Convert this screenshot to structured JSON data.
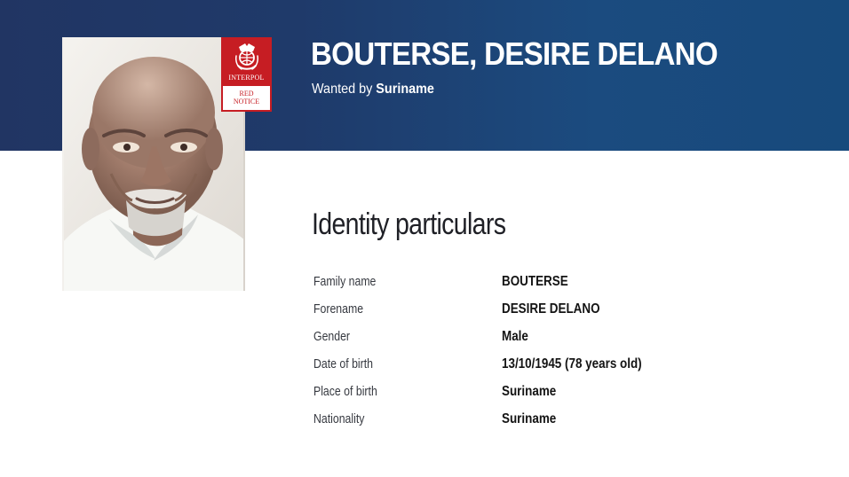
{
  "header": {
    "name": "BOUTERSE, DESIRE DELANO",
    "wanted_prefix": "Wanted by",
    "wanted_country": "Suriname"
  },
  "notice_badge": {
    "organization": "INTERPOL",
    "line_1": "RED",
    "line_2": "NOTICE",
    "background_color": "#c61d23",
    "icon": "interpol-emblem-icon"
  },
  "photo": {
    "description": "portrait-photo"
  },
  "identity": {
    "title": "Identity particulars",
    "rows": [
      {
        "label": "Family name",
        "value": "BOUTERSE"
      },
      {
        "label": "Forename",
        "value": "DESIRE DELANO"
      },
      {
        "label": "Gender",
        "value": "Male"
      },
      {
        "label": "Date of birth",
        "value": "13/10/1945 (78 years old)"
      },
      {
        "label": "Place of birth",
        "value": "Suriname"
      },
      {
        "label": "Nationality",
        "value": "Suriname"
      }
    ]
  },
  "colors": {
    "banner_left": "#213563",
    "banner_right": "#174a7c",
    "accent_red": "#c61d23"
  }
}
